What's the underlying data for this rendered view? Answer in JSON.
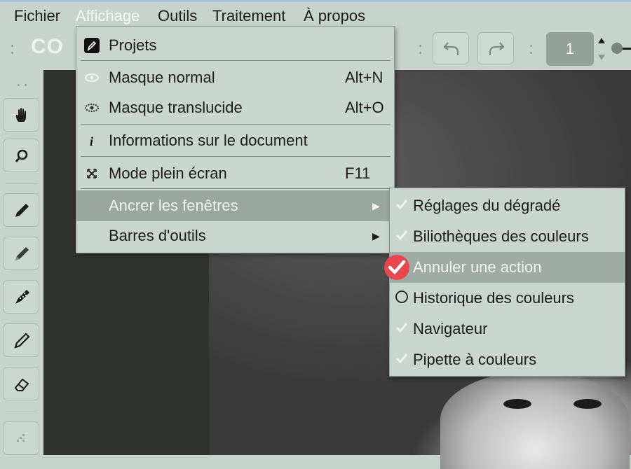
{
  "menubar": {
    "items": [
      "Fichier",
      "Affichage",
      "Outils",
      "Traitement",
      "À propos"
    ],
    "active_index": 1
  },
  "toolbar": {
    "logo_text": "CO",
    "page_number": "1"
  },
  "view_menu": {
    "items": [
      {
        "label": "Projets",
        "shortcut": "",
        "icon": "project-pen-icon"
      },
      {
        "label": "Masque normal",
        "shortcut": "Alt+N",
        "icon": "eye-icon"
      },
      {
        "label": "Masque translucide",
        "shortcut": "Alt+O",
        "icon": "translucent-eye-icon"
      },
      {
        "label": "Informations sur le document",
        "shortcut": "",
        "icon": "info-icon"
      },
      {
        "label": "Mode plein écran",
        "shortcut": "F11",
        "icon": "fullscreen-icon"
      },
      {
        "label": "Ancrer les fenêtres",
        "shortcut": "",
        "icon": "submenu-arrow-icon"
      },
      {
        "label": "Barres d'outils",
        "shortcut": "",
        "icon": "submenu-arrow-icon"
      }
    ]
  },
  "dock_submenu": {
    "items": [
      {
        "label": "Réglages du dégradé",
        "checked": true
      },
      {
        "label": "Biliothèques des couleurs",
        "checked": true
      },
      {
        "label": "Annuler une action",
        "checked": true
      },
      {
        "label": "Historique des couleurs",
        "checked": false
      },
      {
        "label": "Navigateur",
        "checked": true
      },
      {
        "label": "Pipette à couleurs",
        "checked": true
      }
    ],
    "highlight_index": 2
  },
  "colors": {
    "menu_bg": "#cbd5d0",
    "highlight": "#9ca6a1",
    "accent_check": "#e8474f",
    "dark_panel": "#2f322f"
  }
}
